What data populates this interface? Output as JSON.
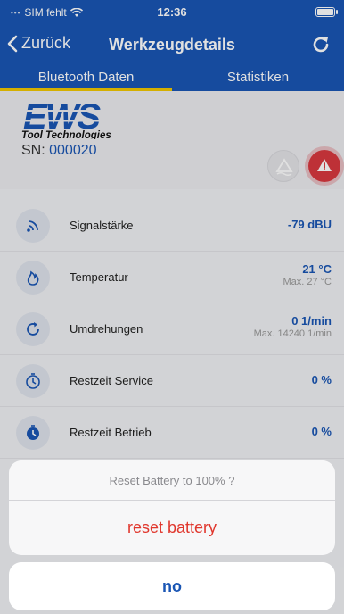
{
  "status_bar": {
    "carrier": "SIM fehlt",
    "time": "12:36"
  },
  "nav": {
    "back_label": "Zurück",
    "title": "Werkzeugdetails"
  },
  "tabs": [
    {
      "label": "Bluetooth Daten",
      "active": true
    },
    {
      "label": "Statistiken",
      "active": false
    }
  ],
  "device": {
    "logo_text": "EWS",
    "logo_subtitle": "Tool Technologies",
    "sn_label": "SN:",
    "sn_value": "000020"
  },
  "metrics": [
    {
      "icon": "signal-icon",
      "label": "Signalstärke",
      "value": "-79 dBU",
      "sub": ""
    },
    {
      "icon": "flame-icon",
      "label": "Temperatur",
      "value": "21 °C",
      "sub": "Max. 27 °C"
    },
    {
      "icon": "rotation-icon",
      "label": "Umdrehungen",
      "value": "0 1/min",
      "sub": "Max. 14240 1/min"
    },
    {
      "icon": "timer-service-icon",
      "label": "Restzeit Service",
      "value": "0 %",
      "sub": ""
    },
    {
      "icon": "timer-operation-icon",
      "label": "Restzeit Betrieb",
      "value": "0 %",
      "sub": ""
    }
  ],
  "action_sheet": {
    "message": "Reset Battery to 100% ?",
    "action": "reset battery",
    "cancel": "no"
  },
  "colors": {
    "brand_blue": "#1a56b4",
    "destructive_red": "#e0362c",
    "tab_indicator": "#f2c800",
    "alert_red": "#d9383f"
  }
}
